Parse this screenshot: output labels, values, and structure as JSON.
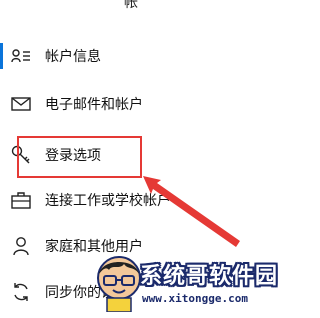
{
  "top_fragment": "帐",
  "nav": {
    "items": [
      {
        "label": "帐户信息",
        "icon": "account-info-icon"
      },
      {
        "label": "电子邮件和帐户",
        "icon": "mail-icon"
      },
      {
        "label": "登录选项",
        "icon": "key-icon"
      },
      {
        "label": "连接工作或学校帐户",
        "icon": "briefcase-icon"
      },
      {
        "label": "家庭和其他用户",
        "icon": "person-icon"
      },
      {
        "label": "同步你的设置",
        "icon": "sync-icon"
      }
    ]
  },
  "watermark": {
    "title": "系统哥软件园",
    "url": "www.xitongge.com"
  },
  "colors": {
    "accent": "#0a74da",
    "highlight": "#e53935",
    "text": "#111111"
  }
}
